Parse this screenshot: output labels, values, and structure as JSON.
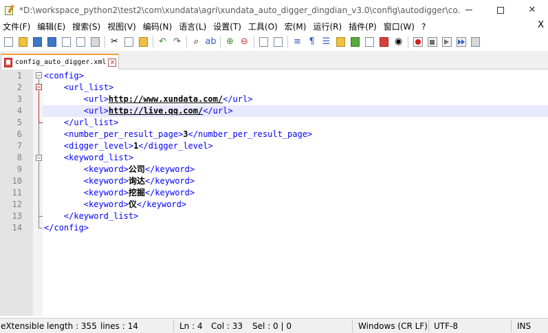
{
  "window": {
    "title": "*D:\\workspace_python2\\test2\\com\\xundata\\agri\\xundata_auto_digger_dingdian_v3.0\\config\\autodigger\\co..."
  },
  "menu": {
    "items": [
      "文件(F)",
      "编辑(E)",
      "搜索(S)",
      "视图(V)",
      "编码(N)",
      "语言(L)",
      "设置(T)",
      "工具(O)",
      "宏(M)",
      "运行(R)",
      "插件(P)",
      "窗口(W)",
      "?"
    ],
    "close_label": "X"
  },
  "tab": {
    "label": "config_auto_digger.xml",
    "close_label": "x"
  },
  "editor": {
    "current_line": 4,
    "line_numbers": [
      "1",
      "2",
      "3",
      "4",
      "5",
      "6",
      "7",
      "8",
      "9",
      "10",
      "11",
      "12",
      "13",
      "14"
    ],
    "lines": [
      {
        "parts": [
          {
            "t": "tag",
            "v": "<config>"
          }
        ]
      },
      {
        "parts": [
          {
            "t": "sp",
            "v": "    "
          },
          {
            "t": "tag",
            "v": "<url_list>"
          }
        ]
      },
      {
        "parts": [
          {
            "t": "sp",
            "v": "        "
          },
          {
            "t": "tag",
            "v": "<url>"
          },
          {
            "t": "link",
            "v": "http://www.xundata.com/"
          },
          {
            "t": "tag",
            "v": "</url>"
          }
        ]
      },
      {
        "parts": [
          {
            "t": "sp",
            "v": "        "
          },
          {
            "t": "tag",
            "v": "<url>"
          },
          {
            "t": "link",
            "v": "http://live.qq.com/"
          },
          {
            "t": "tag",
            "v": "</url>"
          }
        ]
      },
      {
        "parts": [
          {
            "t": "sp",
            "v": "    "
          },
          {
            "t": "tag",
            "v": "</url_list>"
          }
        ]
      },
      {
        "parts": [
          {
            "t": "sp",
            "v": "    "
          },
          {
            "t": "tag",
            "v": "<number_per_result_page>"
          },
          {
            "t": "txt",
            "v": "3"
          },
          {
            "t": "tag",
            "v": "</number_per_result_page>"
          }
        ]
      },
      {
        "parts": [
          {
            "t": "sp",
            "v": "    "
          },
          {
            "t": "tag",
            "v": "<digger_level>"
          },
          {
            "t": "txt",
            "v": "1"
          },
          {
            "t": "tag",
            "v": "</digger_level>"
          }
        ]
      },
      {
        "parts": [
          {
            "t": "sp",
            "v": "    "
          },
          {
            "t": "tag",
            "v": "<keyword_list>"
          }
        ]
      },
      {
        "parts": [
          {
            "t": "sp",
            "v": "        "
          },
          {
            "t": "tag",
            "v": "<keyword>"
          },
          {
            "t": "cjk",
            "v": "公司"
          },
          {
            "t": "tag",
            "v": "</keyword>"
          }
        ]
      },
      {
        "parts": [
          {
            "t": "sp",
            "v": "        "
          },
          {
            "t": "tag",
            "v": "<keyword>"
          },
          {
            "t": "cjk",
            "v": "询达"
          },
          {
            "t": "tag",
            "v": "</keyword>"
          }
        ]
      },
      {
        "parts": [
          {
            "t": "sp",
            "v": "        "
          },
          {
            "t": "tag",
            "v": "<keyword>"
          },
          {
            "t": "cjk",
            "v": "挖掘"
          },
          {
            "t": "tag",
            "v": "</keyword>"
          }
        ]
      },
      {
        "parts": [
          {
            "t": "sp",
            "v": "        "
          },
          {
            "t": "tag",
            "v": "<keyword>"
          },
          {
            "t": "cjk",
            "v": "仪"
          },
          {
            "t": "tag",
            "v": "</keyword>"
          }
        ]
      },
      {
        "parts": [
          {
            "t": "sp",
            "v": "    "
          },
          {
            "t": "tag",
            "v": "</keyword_list>"
          }
        ]
      },
      {
        "parts": [
          {
            "t": "tag",
            "v": "</config>"
          }
        ]
      }
    ]
  },
  "status": {
    "filetype": "eXtensible",
    "length": "length : 355",
    "lines": "lines : 14",
    "ln": "Ln : 4",
    "col": "Col : 33",
    "sel": "Sel : 0 | 0",
    "eol": "Windows (CR LF)",
    "encoding": "UTF-8",
    "mode": "INS"
  },
  "colors": {
    "tag": "#0000ff",
    "current_line": "#e8e8ff",
    "fold_active": "#c03030"
  }
}
